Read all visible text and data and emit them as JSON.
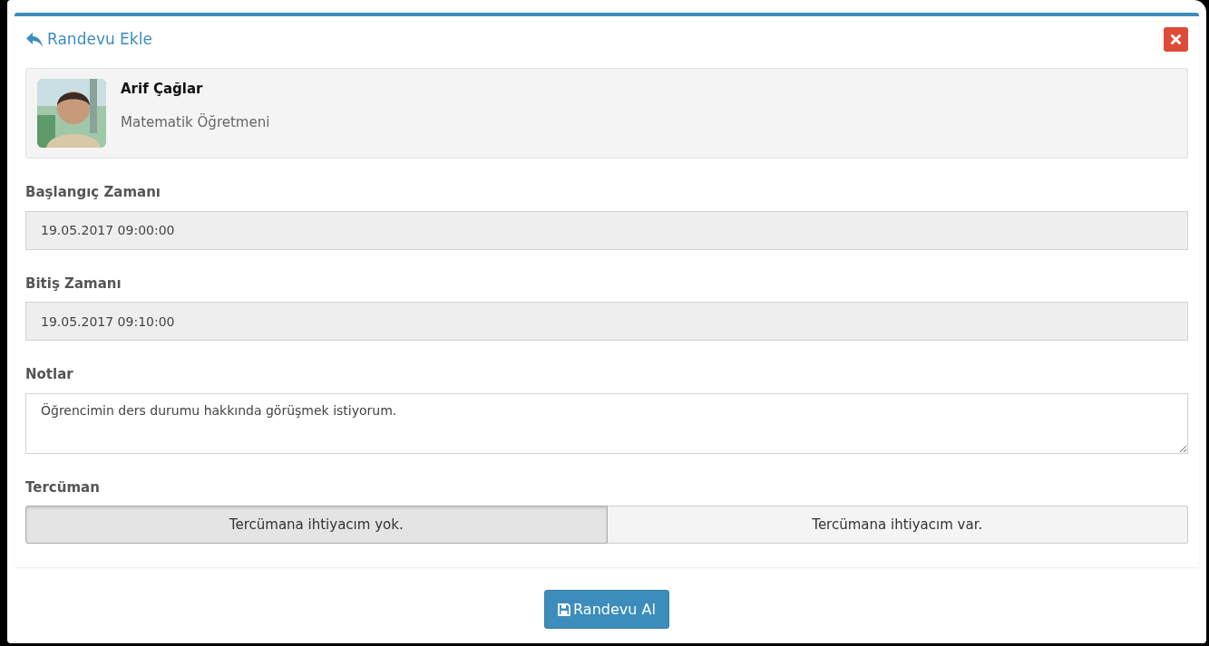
{
  "header": {
    "title": "Randevu Ekle"
  },
  "teacher": {
    "name": "Arif Çağlar",
    "role": "Matematik Öğretmeni"
  },
  "fields": [
    {
      "label": "Başlangıç Zamanı",
      "value": "19.05.2017 09:00:00",
      "disabled": true,
      "kind": "input"
    },
    {
      "label": "Bitiş Zamanı",
      "value": "19.05.2017 09:10:00",
      "disabled": true,
      "kind": "input"
    },
    {
      "label": "Notlar",
      "value": "Öğrencimin ders durumu hakkında görüşmek istiyorum.",
      "disabled": false,
      "kind": "textarea"
    }
  ],
  "translator": {
    "label": "Tercüman",
    "options": [
      {
        "label": "Tercümana ihtiyacım yok.",
        "selected": true
      },
      {
        "label": "Tercümana ihtiyacım var.",
        "selected": false
      }
    ]
  },
  "submit": {
    "label": "Randevu Al"
  }
}
